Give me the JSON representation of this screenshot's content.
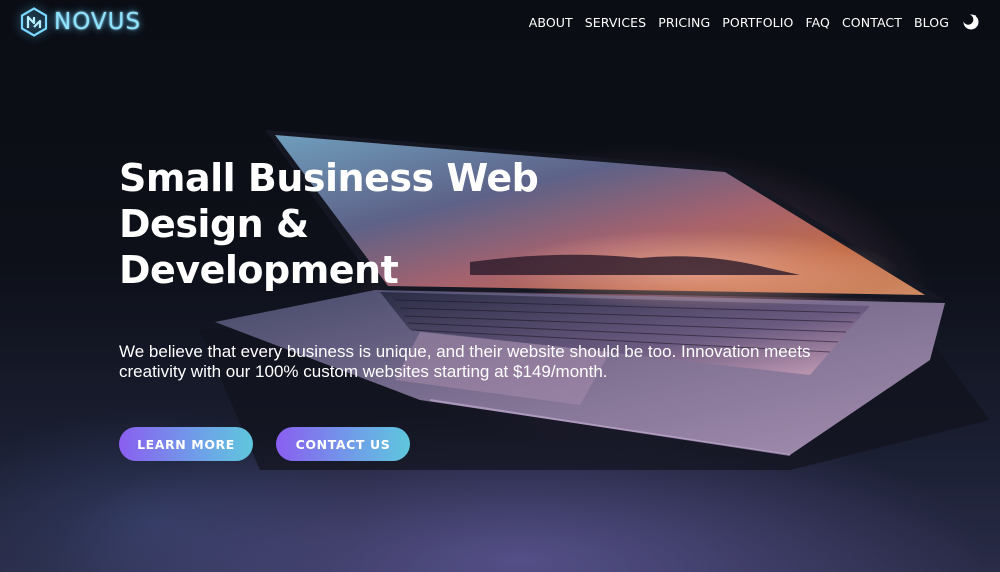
{
  "brand": {
    "name": "NOVUS",
    "accent": "#8fe3ff"
  },
  "nav": {
    "items": [
      {
        "label": "ABOUT"
      },
      {
        "label": "SERVICES"
      },
      {
        "label": "PRICING"
      },
      {
        "label": "PORTFOLIO"
      },
      {
        "label": "FAQ"
      },
      {
        "label": "CONTACT"
      },
      {
        "label": "BLOG"
      }
    ],
    "theme_toggle_icon": "moon-icon"
  },
  "hero": {
    "title_lines": [
      "Small Business Web",
      "Design &",
      "Development"
    ],
    "description": "We believe that every business is unique, and their website should be too. Innovation meets creativity with our 100% custom websites starting at $149/month.",
    "buttons": {
      "learn_more": "LEARN MORE",
      "contact_us": "CONTACT US"
    },
    "button_gradient": [
      "#8a5ef0",
      "#5fc7dd"
    ],
    "background_image": "dark laptop photo"
  }
}
